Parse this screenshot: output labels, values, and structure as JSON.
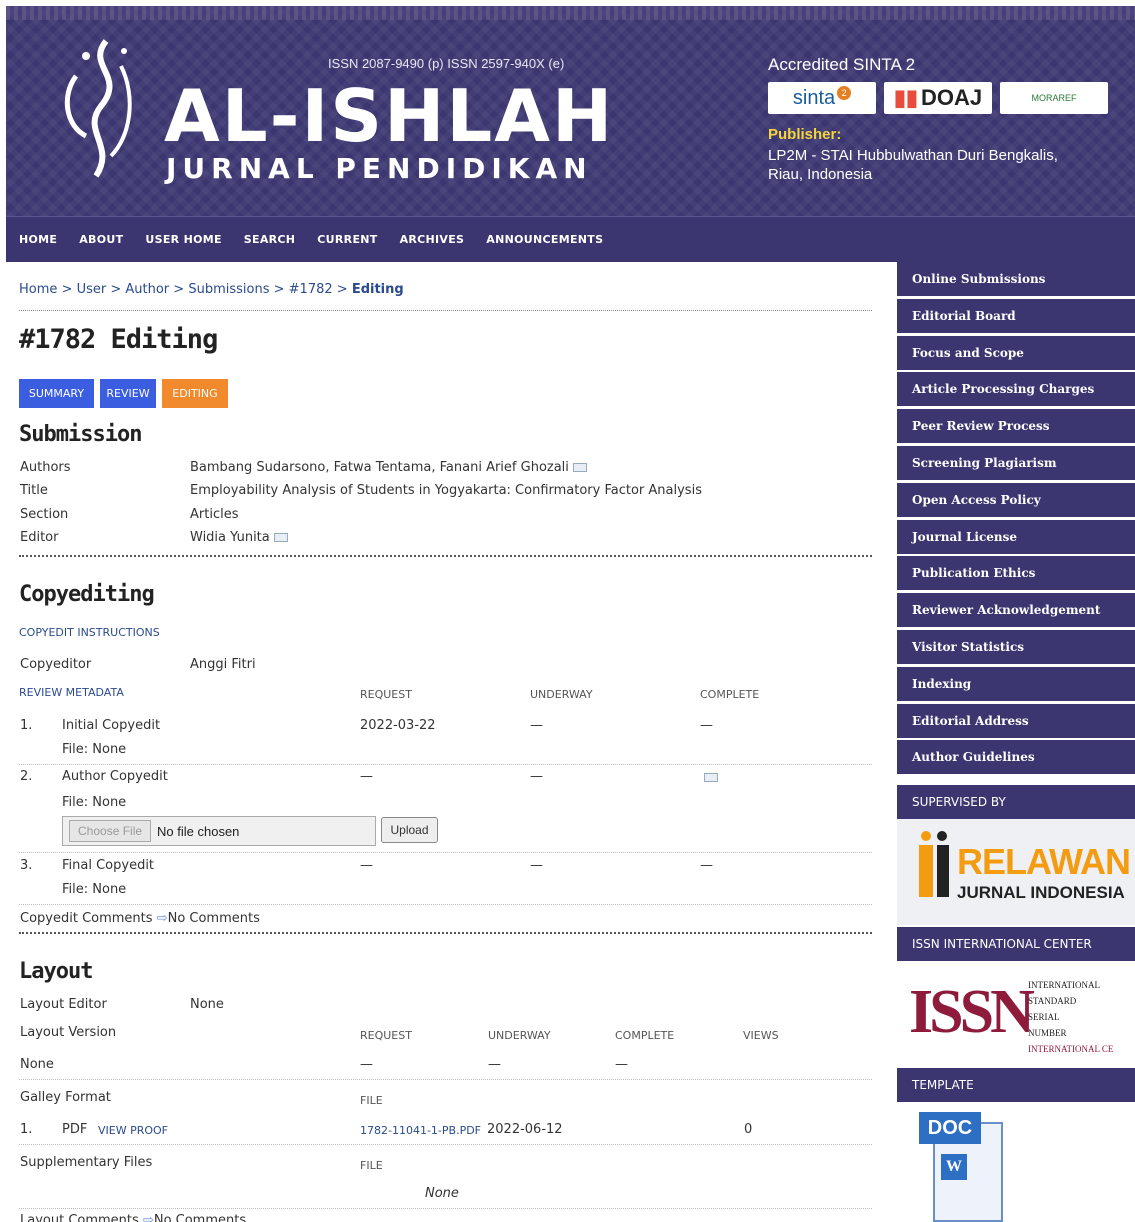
{
  "header": {
    "issn": "ISSN 2087-9490 (p) ISSN 2597-940X (e)",
    "journal_name": "AL-ISHLAH",
    "journal_sub": "JURNAL PENDIDIKAN",
    "accredited": "Accredited SINTA 2",
    "badges": {
      "sinta": "sinta",
      "sinta_num": "2",
      "doaj": "DOAJ",
      "moraref": "MORAREF"
    },
    "publisher_label": "Publisher:",
    "publisher_text": "LP2M - STAI Hubbulwathan Duri Bengkalis, Riau, Indonesia"
  },
  "nav": [
    "HOME",
    "ABOUT",
    "USER HOME",
    "SEARCH",
    "CURRENT",
    "ARCHIVES",
    "ANNOUNCEMENTS"
  ],
  "breadcrumb": {
    "home": "Home",
    "user": "User",
    "author": "Author",
    "submissions": "Submissions",
    "id": "#1782",
    "current": "Editing",
    "sep": " > "
  },
  "page_title": "#1782 Editing",
  "tabs": {
    "summary": "SUMMARY",
    "review": "REVIEW",
    "editing": "EDITING"
  },
  "submission": {
    "heading": "Submission",
    "authors_label": "Authors",
    "authors": "Bambang Sudarsono, Fatwa Tentama, Fanani Arief Ghozali",
    "title_label": "Title",
    "title": "Employability Analysis of Students in Yogyakarta: Confirmatory Factor Analysis",
    "section_label": "Section",
    "section": "Articles",
    "editor_label": "Editor",
    "editor": "Widia Yunita"
  },
  "copyediting": {
    "heading": "Copyediting",
    "instructions": "COPYEDIT INSTRUCTIONS",
    "copyeditor_label": "Copyeditor",
    "copyeditor": "Anggi Fitri",
    "review_metadata": "REVIEW METADATA",
    "col_request": "REQUEST",
    "col_underway": "UNDERWAY",
    "col_complete": "COMPLETE",
    "rows": [
      {
        "num": "1.",
        "name": "Initial Copyedit",
        "file": "File: None",
        "request": "2022-03-22",
        "underway": "—",
        "complete": "—"
      },
      {
        "num": "2.",
        "name": "Author Copyedit",
        "file": "File: None",
        "request": "—",
        "underway": "—",
        "complete": ""
      },
      {
        "num": "3.",
        "name": "Final Copyedit",
        "file": "File: None",
        "request": "—",
        "underway": "—",
        "complete": "—"
      }
    ],
    "choose_file": "Choose File",
    "no_file": "No file chosen",
    "upload": "Upload",
    "comments_label": "Copyedit Comments",
    "comments_value": "No Comments"
  },
  "layout": {
    "heading": "Layout",
    "editor_label": "Layout Editor",
    "editor": "None",
    "version_label": "Layout Version",
    "col_request": "REQUEST",
    "col_underway": "UNDERWAY",
    "col_complete": "COMPLETE",
    "col_views": "VIEWS",
    "version_value": "None",
    "request": "—",
    "underway": "—",
    "complete": "—",
    "galley_label": "Galley Format",
    "col_file": "FILE",
    "galley_num": "1.",
    "galley_format": "PDF",
    "view_proof": "VIEW PROOF",
    "galley_file": "1782-11041-1-PB.PDF",
    "galley_date": "2022-06-12",
    "galley_views": "0",
    "supp_label": "Supplementary Files",
    "supp_col_file": "FILE",
    "supp_none": "None",
    "comments_label": "Layout Comments",
    "comments_value": "No Comments"
  },
  "sidebar": {
    "items": [
      "Online Submissions",
      "Editorial Board",
      "Focus and Scope",
      "Article Processing Charges",
      "Peer Review Process",
      "Screening Plagiarism",
      "Open Access Policy",
      "Journal License",
      "Publication Ethics",
      "Reviewer Acknowledgement",
      "Visitor Statistics",
      "Indexing",
      "Editorial Address",
      "Author Guidelines"
    ],
    "supervised_by": "SUPERVISED BY",
    "rji_main": "RELAWAN",
    "rji_sub": "JURNAL INDONESIA",
    "issn_center": "ISSN INTERNATIONAL CENTER",
    "issn_text_1": "INTERNATIONAL",
    "issn_text_2": "STANDARD",
    "issn_text_3": "SERIAL",
    "issn_text_4": "NUMBER",
    "issn_text_5": "INTERNATIONAL CE",
    "template": "TEMPLATE",
    "doc_label": "DOC"
  }
}
